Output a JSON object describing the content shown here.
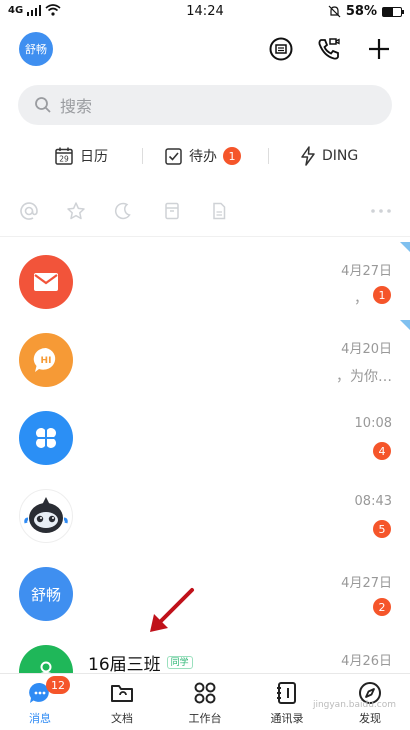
{
  "status_bar": {
    "signal": "4G",
    "time": "14:24",
    "battery": "58%",
    "battery_level": 0.58
  },
  "header": {
    "avatar_text": "舒畅"
  },
  "search": {
    "placeholder": "搜索"
  },
  "quick": {
    "calendar_label": "日历",
    "calendar_day": "29",
    "todo_label": "待办",
    "todo_count": "1",
    "ding_label": "DING"
  },
  "conversations": [
    {
      "name": "",
      "time": "4月27日",
      "preview": "，",
      "badge": "1",
      "avatar_color": "#f2543a",
      "icon": "mail-icon",
      "avatar_text": ""
    },
    {
      "name": "",
      "time": "4月20日",
      "preview": "，为你…",
      "badge": "",
      "avatar_color": "#f69a36",
      "icon": "hi-chat-icon",
      "avatar_text": "HI"
    },
    {
      "name": "",
      "time": "10:08",
      "preview": "",
      "badge": "4",
      "avatar_color": "#2b8ff5",
      "icon": "clover-icon",
      "avatar_text": ""
    },
    {
      "name": "",
      "time": "08:43",
      "preview": "",
      "badge": "5",
      "avatar_color": "#ffffff",
      "icon": "robot-icon",
      "avatar_text": ""
    },
    {
      "name": "",
      "time": "4月27日",
      "preview": "",
      "badge": "2",
      "avatar_color": "#3f8ff0",
      "icon": "",
      "avatar_text": "舒畅"
    },
    {
      "name": "16届三班",
      "tag": "同学",
      "time": "4月26日",
      "preview": "",
      "badge": "",
      "avatar_color": "#1fb759",
      "icon": "group-icon",
      "avatar_text": ""
    }
  ],
  "tabs": [
    {
      "label": "消息",
      "badge": "12",
      "icon": "message-icon"
    },
    {
      "label": "文档",
      "icon": "folder-icon"
    },
    {
      "label": "工作台",
      "icon": "apps-icon"
    },
    {
      "label": "通讯录",
      "icon": "contacts-icon"
    },
    {
      "label": "发现",
      "icon": "compass-icon"
    }
  ],
  "colors": {
    "accent": "#2f8bf4",
    "badge": "#f5552a"
  },
  "watermark": "jingyan.baidu.com"
}
